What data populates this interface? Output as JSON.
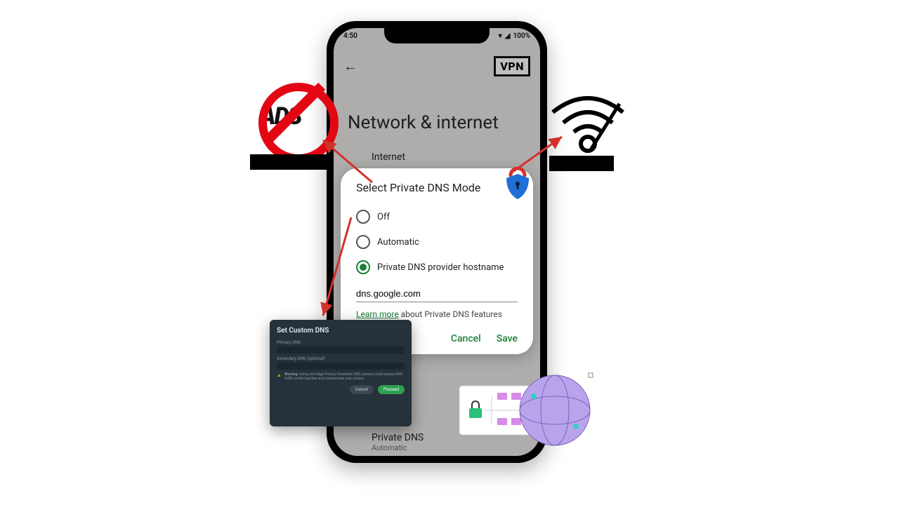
{
  "phone": {
    "status": {
      "time": "4:50",
      "battery": "100%"
    },
    "header": {
      "vpn_badge": "VPN"
    },
    "page_title": "Network & internet",
    "rows": {
      "internet": {
        "label": "Internet"
      },
      "private": {
        "label": "Private DNS",
        "sub": "Automatic"
      }
    }
  },
  "dialog": {
    "title": "Select Private DNS Mode",
    "options": {
      "off": "Off",
      "auto": "Automatic",
      "hostname": "Private DNS provider hostname"
    },
    "dns_value": "dns.google.com",
    "learn_link": "Learn more",
    "learn_rest": " about Private DNS features",
    "cancel": "Cancel",
    "save": "Save"
  },
  "dark_panel": {
    "title": "Set Custom DNS",
    "primary_label": "Primary DNS",
    "secondary_label": "Secondary DNS (optional)",
    "warning_label": "Warning:",
    "warning_text": "Using non-Edge Privacy Protection DNS servers could expose DNS traffic to third parties and compromise your privacy.",
    "cancel": "Cancel",
    "proceed": "Proceed"
  },
  "badges": {
    "noads_text": "ADS",
    "noads_label": "",
    "wifi_label": ""
  }
}
